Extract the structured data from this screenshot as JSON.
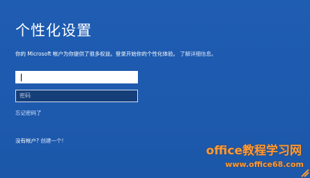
{
  "window": {
    "title": "个性化设置"
  },
  "description": {
    "text": "你的 Microsoft 帐户为你提供了很多权益。登录开始你的个性化体验。",
    "link_text": "了解详细信息。"
  },
  "form": {
    "account_value": "",
    "password_placeholder": "密码",
    "forgot_password": "忘记密码了"
  },
  "signup": {
    "prefix": "没有帐户?",
    "link_text": "创建一个!"
  },
  "watermark": {
    "main": "office教程学习网",
    "url": "www.office68.com"
  },
  "colors": {
    "background": "#1f5db3",
    "text": "#ffffff",
    "link": "#d7e6ff",
    "watermark": "#ff9a36"
  }
}
